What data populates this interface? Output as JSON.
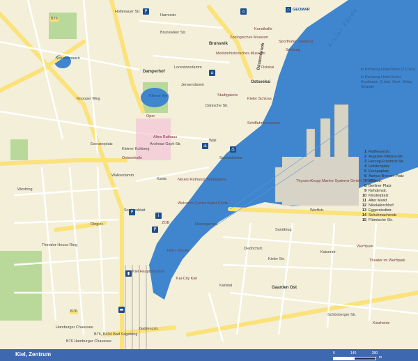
{
  "map": {
    "title": "Kiel, Zentrum",
    "scale": {
      "ticks": [
        "0",
        "140",
        "280"
      ],
      "unit": "m"
    },
    "water_label": "Kieler Förde",
    "district_labels": [
      "Düsternbrook",
      "Damperhof",
      "Brunswik",
      "Gaarden Ost",
      "Ostseekai"
    ],
    "street_labels": [
      "Holtenauer Str.",
      "Brunswiker Str.",
      "Harmsstr.",
      "Lorentzendamm",
      "Jensendamm",
      "Dänische Str.",
      "Kleiner Kuhberg",
      "Exerzierplatz",
      "Sophienblatt",
      "Hamburger Chaussee",
      "Karlstal",
      "Werftstr.",
      "Kaistr.",
      "Wall",
      "Schwedenkai",
      "Norwegenkai",
      "Andreas-Gayk-Str.",
      "Walkerdamm",
      "Ringstr.",
      "Knooper Weg",
      "Westring",
      "Gablenzstr.",
      "Kieler Str.",
      "Schönberger Str.",
      "Diedrichstr.",
      "Theodor-Heuss-Ring",
      "Sandkrug",
      "Kaiserstr."
    ],
    "poi_labels": [
      "GEOMAR",
      "Zoologisches Museum",
      "Medizinhistorisches Museum",
      "Kunsthalle",
      "Schiffahrtsmuseum",
      "Stadtgalerie",
      "Oper",
      "Altes Rathaus",
      "Neues Rathaus/ Stadtgalerie",
      "Hörn- brücke",
      "Kieler Schloss",
      "ZOB",
      "Kiel Hauptbahnhof",
      "Welcome Center Kieler Förde",
      "ThyssenKrupp Marine Systems GmbH (TKMS)",
      "Theater im Werftpark",
      "Werftpark",
      "Kleiner Kiel",
      "Schreventeich",
      "Ostseehalle",
      "Seeburg",
      "Kai-City Kiel",
      "Katzheide",
      "Sporthafen Seeburg",
      "Oslokai"
    ],
    "road_shields": [
      "B76",
      "B76",
      "B76, B404 Bad Segeberg",
      "B76 Hamburger Chaussee"
    ],
    "directions": [
      "in Richtung Hotel Birke (2,5 km)",
      "in Richtung Hotel Kieler Kaufmann (1 km), Rest. Moby, Strande"
    ],
    "legend": [
      {
        "num": "1",
        "name": "Raiffeisenstr."
      },
      {
        "num": "2",
        "name": "Auguste-Viktoria-Str."
      },
      {
        "num": "3",
        "name": "Herzog-Friedrich-Str."
      },
      {
        "num": "4",
        "name": "Holstenplatz"
      },
      {
        "num": "5",
        "name": "Europaplatz"
      },
      {
        "num": "6",
        "name": "Asmus-Bremer-Platz"
      },
      {
        "num": "7",
        "name": "Willestr."
      },
      {
        "num": "8",
        "name": "Berliner Platz"
      },
      {
        "num": "9",
        "name": "Kehdenstr."
      },
      {
        "num": "10",
        "name": "Klosterplatz"
      },
      {
        "num": "11",
        "name": "Alter Markt"
      },
      {
        "num": "12",
        "name": "Nikolaikirchhof"
      },
      {
        "num": "13",
        "name": "Eggerstedtstr."
      },
      {
        "num": "14",
        "name": "Schuhmacherstr."
      },
      {
        "num": "15",
        "name": "Flämische Str."
      }
    ],
    "colors": {
      "water": "#3f86cf",
      "land": "#f3efd9",
      "road_major": "#fbe27a",
      "road_minor": "#ffffff",
      "park": "#b9d99a",
      "footer": "#3e68b0",
      "pedestrian": "#f4c5d8"
    }
  }
}
